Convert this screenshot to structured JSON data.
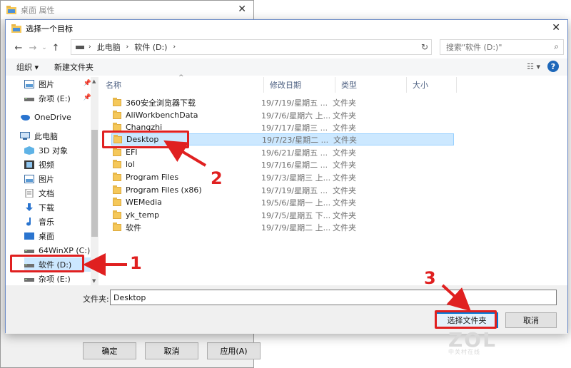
{
  "background_window": {
    "title": "桌面 属性",
    "buttons": {
      "ok": "确定",
      "cancel": "取消",
      "apply": "应用(A)"
    }
  },
  "dialog": {
    "title": "选择一个目标",
    "address": {
      "pc": "此电脑",
      "drive": "软件 (D:)"
    },
    "search_placeholder": "搜索\"软件 (D:)\"",
    "toolbar": {
      "organize": "组织 ▾",
      "new_folder": "新建文件夹"
    },
    "nav_items": [
      {
        "label": "图片",
        "icon": "pictures-icon",
        "pinned": true
      },
      {
        "label": "杂项 (E:)",
        "icon": "drive-icon",
        "pinned": true
      },
      {
        "label": "OneDrive",
        "icon": "cloud-icon"
      },
      {
        "label": "此电脑",
        "icon": "computer-icon"
      },
      {
        "label": "3D 对象",
        "icon": "3d-objects-icon"
      },
      {
        "label": "视频",
        "icon": "videos-icon"
      },
      {
        "label": "图片",
        "icon": "pictures-icon"
      },
      {
        "label": "文档",
        "icon": "documents-icon"
      },
      {
        "label": "下载",
        "icon": "download-icon"
      },
      {
        "label": "音乐",
        "icon": "music-icon"
      },
      {
        "label": "桌面",
        "icon": "desktop-icon"
      },
      {
        "label": "64WinXP (C:)",
        "icon": "drive-icon"
      },
      {
        "label": "软件 (D:)",
        "icon": "drive-icon"
      },
      {
        "label": "杂项 (E:)",
        "icon": "drive-icon"
      }
    ],
    "columns": {
      "name": "名称",
      "modified": "修改日期",
      "type": "类型",
      "size": "大小"
    },
    "files": [
      {
        "name": "360安全浏览器下载",
        "date": "19/7/19/星期五 ...",
        "type": "文件夹"
      },
      {
        "name": "AliWorkbenchData",
        "date": "19/7/6/星期六 上...",
        "type": "文件夹"
      },
      {
        "name": "Changzhi",
        "date": "19/7/17/星期三 ...",
        "type": "文件夹"
      },
      {
        "name": "Desktop",
        "date": "19/7/23/星期二 ...",
        "type": "文件夹"
      },
      {
        "name": "EFI",
        "date": "19/6/21/星期五 ...",
        "type": "文件夹"
      },
      {
        "name": "lol",
        "date": "19/7/16/星期二 ...",
        "type": "文件夹"
      },
      {
        "name": "Program Files",
        "date": "19/7/3/星期三 上...",
        "type": "文件夹"
      },
      {
        "name": "Program Files (x86)",
        "date": "19/7/19/星期五 ...",
        "type": "文件夹"
      },
      {
        "name": "WEMedia",
        "date": "19/5/6/星期一 上...",
        "type": "文件夹"
      },
      {
        "name": "yk_temp",
        "date": "19/7/5/星期五 下...",
        "type": "文件夹"
      },
      {
        "name": "软件",
        "date": "19/7/9/星期二 上...",
        "type": "文件夹"
      }
    ],
    "filename_label": "文件夹:",
    "filename_value": "Desktop",
    "buttons": {
      "select": "选择文件夹",
      "cancel": "取消"
    }
  },
  "annotations": {
    "step1": "1",
    "step2": "2",
    "step3": "3",
    "color": "#e02020"
  },
  "watermark": {
    "logo": "ZOL",
    "sub": "中关村在线"
  }
}
